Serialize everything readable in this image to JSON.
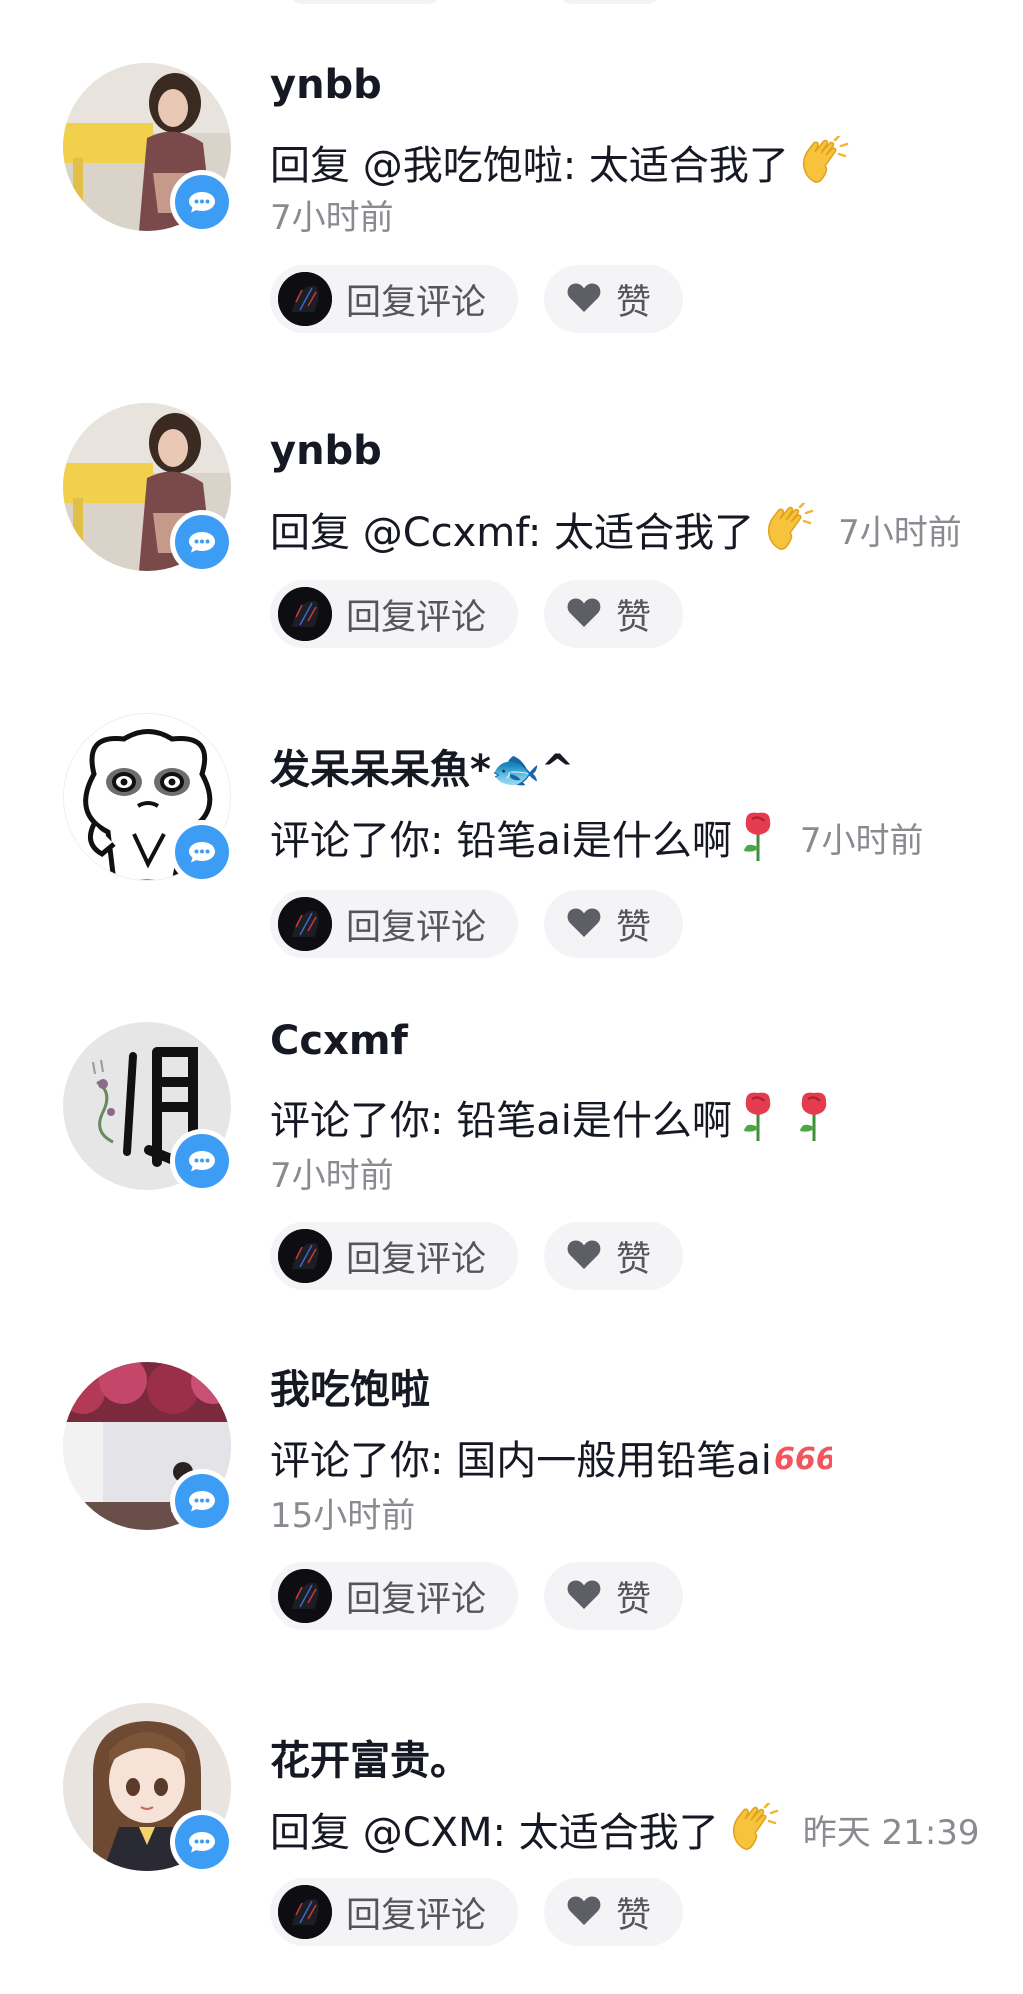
{
  "comments": [
    {
      "username": "ynbb",
      "text": "回复 @我吃饱啦: 太适合我了",
      "emojis": [
        "clap"
      ],
      "time": "7小时前",
      "time_inline": false,
      "avatar": "girl-photo-yellow-chair"
    },
    {
      "username": "ynbb",
      "text": "回复 @Ccxmf: 太适合我了",
      "emojis": [
        "clap"
      ],
      "time": "7小时前",
      "time_inline": true,
      "avatar": "girl-photo-yellow-chair"
    },
    {
      "username": "发呆呆呆魚*🐟^",
      "text": "评论了你: 铅笔ai是什么啊",
      "emojis": [
        "rose"
      ],
      "time": "7小时前",
      "time_inline": true,
      "avatar": "cartoon-bear-sketch"
    },
    {
      "username": "Ccxmf",
      "text": "评论了你: 铅笔ai是什么啊",
      "emojis": [
        "rose",
        "rose"
      ],
      "time": "7小时前",
      "time_inline": false,
      "avatar": "calligraphy-shun"
    },
    {
      "username": "我吃饱啦",
      "text": "评论了你: 国内一般用铅笔ai",
      "emojis": [
        "666"
      ],
      "time": "15小时前",
      "time_inline": false,
      "avatar": "flowers-wall-photo"
    },
    {
      "username": "花开富贵。",
      "text": "回复 @CXM: 太适合我了",
      "emojis": [
        "clap"
      ],
      "time": "昨天 21:39",
      "time_inline": true,
      "avatar": "anime-girl"
    }
  ],
  "actions": {
    "reply_label": "回复评论",
    "like_label": "赞"
  },
  "colors": {
    "badge_blue": "#3d9df5",
    "button_bg": "#f4f4f6",
    "time_gray": "#8a8b91",
    "text_dark": "#161823"
  },
  "icons": {
    "badge": "comment-bubble-icon",
    "like": "heart-icon"
  }
}
